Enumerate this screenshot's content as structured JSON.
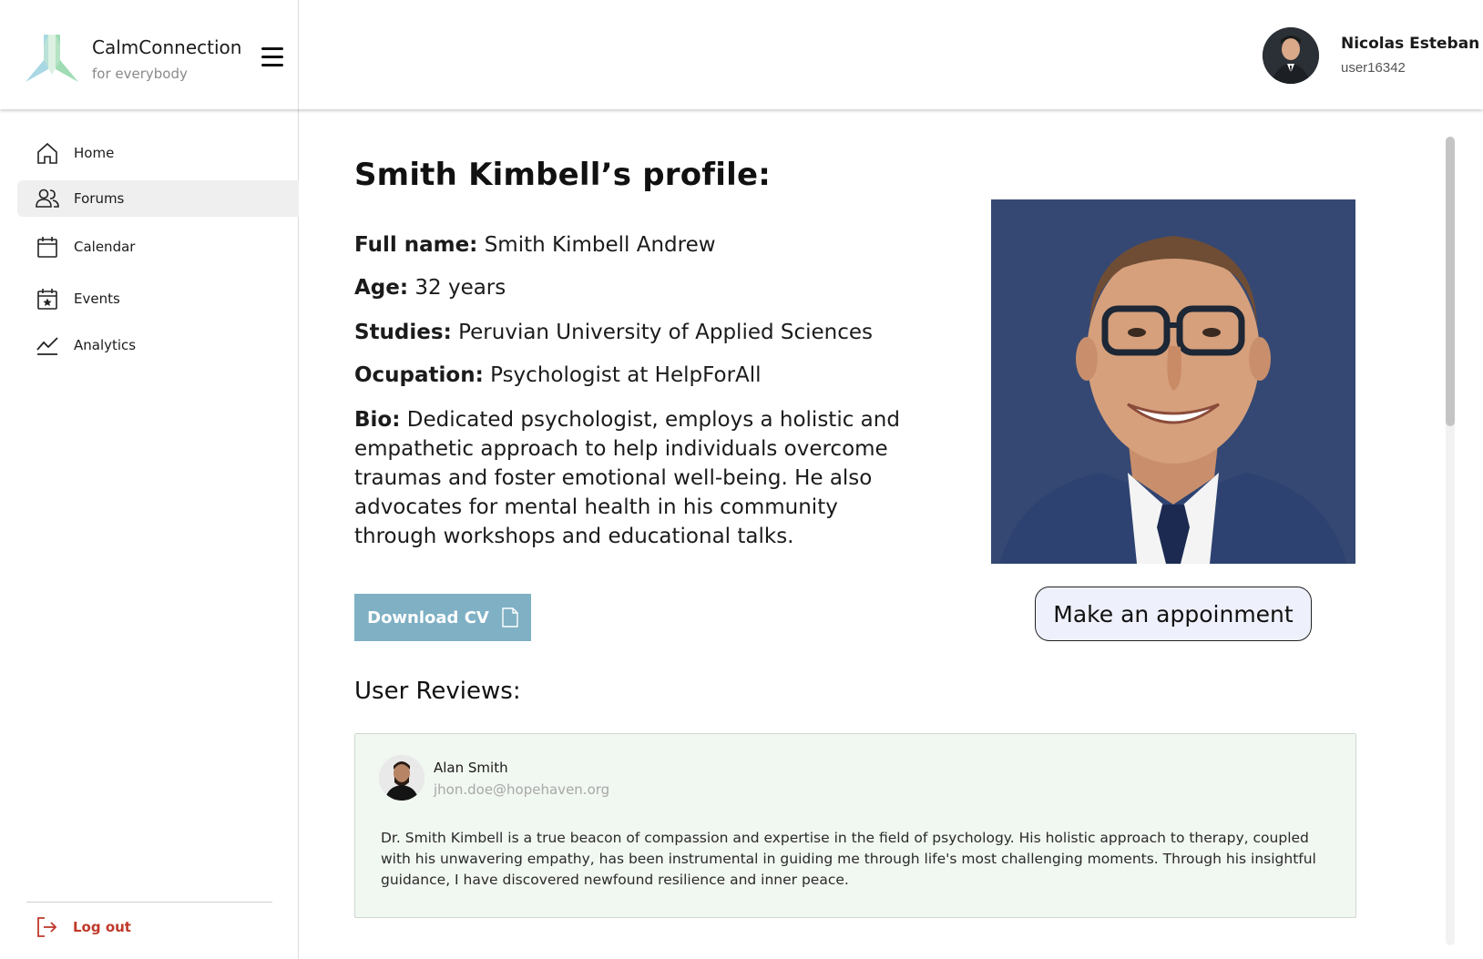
{
  "app": {
    "brand_name": "CalmConnection",
    "brand_tagline": "for everybody"
  },
  "user": {
    "name": "Nicolas Esteban",
    "id": "user16342"
  },
  "sidebar": {
    "items": [
      {
        "label": "Home",
        "icon": "home-icon"
      },
      {
        "label": "Forums",
        "icon": "users-icon",
        "active": true
      },
      {
        "label": "Calendar",
        "icon": "calendar-icon"
      },
      {
        "label": "Events",
        "icon": "star-calendar-icon"
      },
      {
        "label": "Analytics",
        "icon": "chart-line-icon"
      }
    ],
    "logout_label": "Log out"
  },
  "profile": {
    "title": "Smith Kimbell’s profile:",
    "fields": [
      {
        "label": "Full name:",
        "value": "Smith Kimbell Andrew"
      },
      {
        "label": "Age:",
        "value": "32 years"
      },
      {
        "label": "Studies:",
        "value": "Peruvian University of Applied Sciences"
      },
      {
        "label": "Ocupation:",
        "value": "Psychologist at HelpForAll"
      },
      {
        "label": "Bio:",
        "value": "Dedicated psychologist, employs a holistic and empathetic approach to help individuals overcome traumas and foster emotional well-being. He also advocates for mental health in his community through workshops and educational talks."
      }
    ],
    "download_label": "Download CV",
    "appointment_label": "Make an appoinment"
  },
  "reviews": {
    "heading": "User Reviews:",
    "items": [
      {
        "name": "Alan Smith",
        "email": "jhon.doe@hopehaven.org",
        "text": "Dr. Smith Kimbell is a true beacon of compassion and expertise in the field of psychology. His holistic approach to therapy, coupled with his unwavering empathy, has been instrumental in guiding me through life's most challenging moments. Through his insightful guidance, I have discovered newfound resilience and inner peace."
      }
    ]
  },
  "colors": {
    "download_button": "#7fb0c4",
    "appointment_button": "#eef0fb",
    "review_card": "#f1f7f1",
    "photo_background": "#354873",
    "logout": "#c0392b"
  }
}
